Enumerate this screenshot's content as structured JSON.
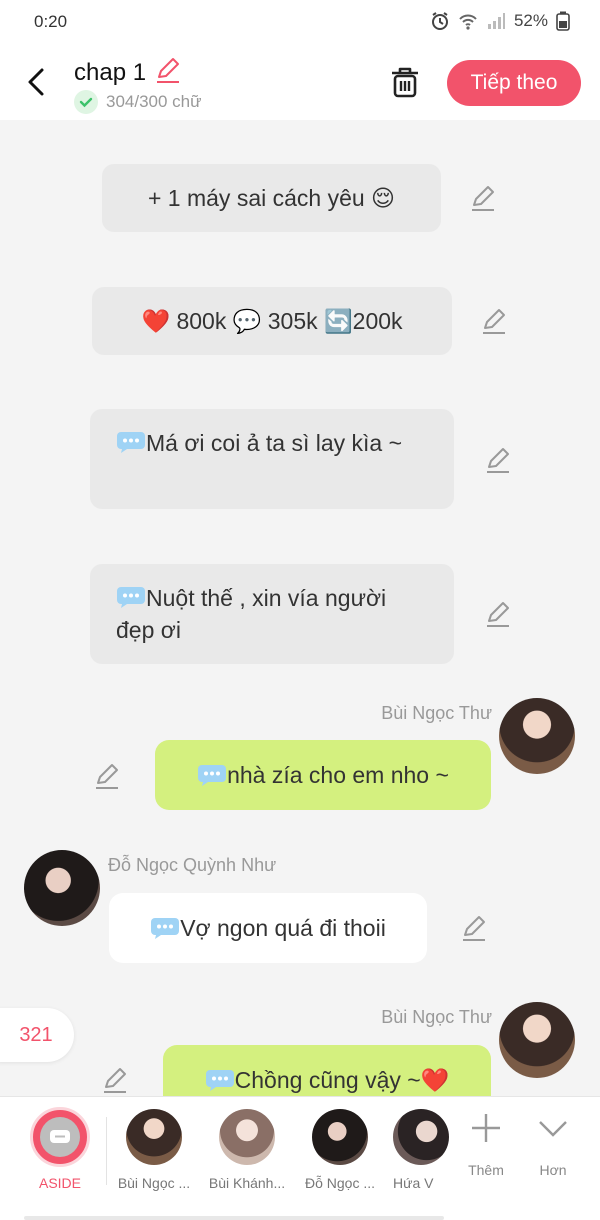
{
  "status": {
    "time": "0:20",
    "battery": "52%"
  },
  "header": {
    "title": "chap 1",
    "word_count": "304/300 chữ",
    "next_label": "Tiếp theo"
  },
  "messages": [
    {
      "text": "+ 1 máy sai cách yêu 😌"
    },
    {
      "text": "❤️ 800k 💬 305k  🔄200k"
    },
    {
      "text": "Má ơi coi ả ta sì lay kìa ~"
    },
    {
      "text": "Nuột thế , xin vía người đẹp ơi"
    },
    {
      "sender": "Bùi Ngọc Thư",
      "text": "nhà zía cho em nho ~"
    },
    {
      "sender": "Đỗ Ngọc Quỳnh Như",
      "text": "Vợ ngon quá đi thoii"
    },
    {
      "sender": "Bùi Ngọc Thư",
      "text": "Chồng cũng vậy ~❤️"
    }
  ],
  "count_badge": "321",
  "bottom": {
    "aside_label": "ASIDE",
    "characters": [
      "Bùi Ngọc ...",
      "Bùi Khánh...",
      "Đỗ Ngọc ...",
      "Hứa V"
    ],
    "add_label": "Thêm",
    "more_label": "Hơn"
  },
  "colors": {
    "accent": "#f2536b",
    "green_bubble": "#d4f07f",
    "gray_bubble": "#e9e9e9"
  }
}
